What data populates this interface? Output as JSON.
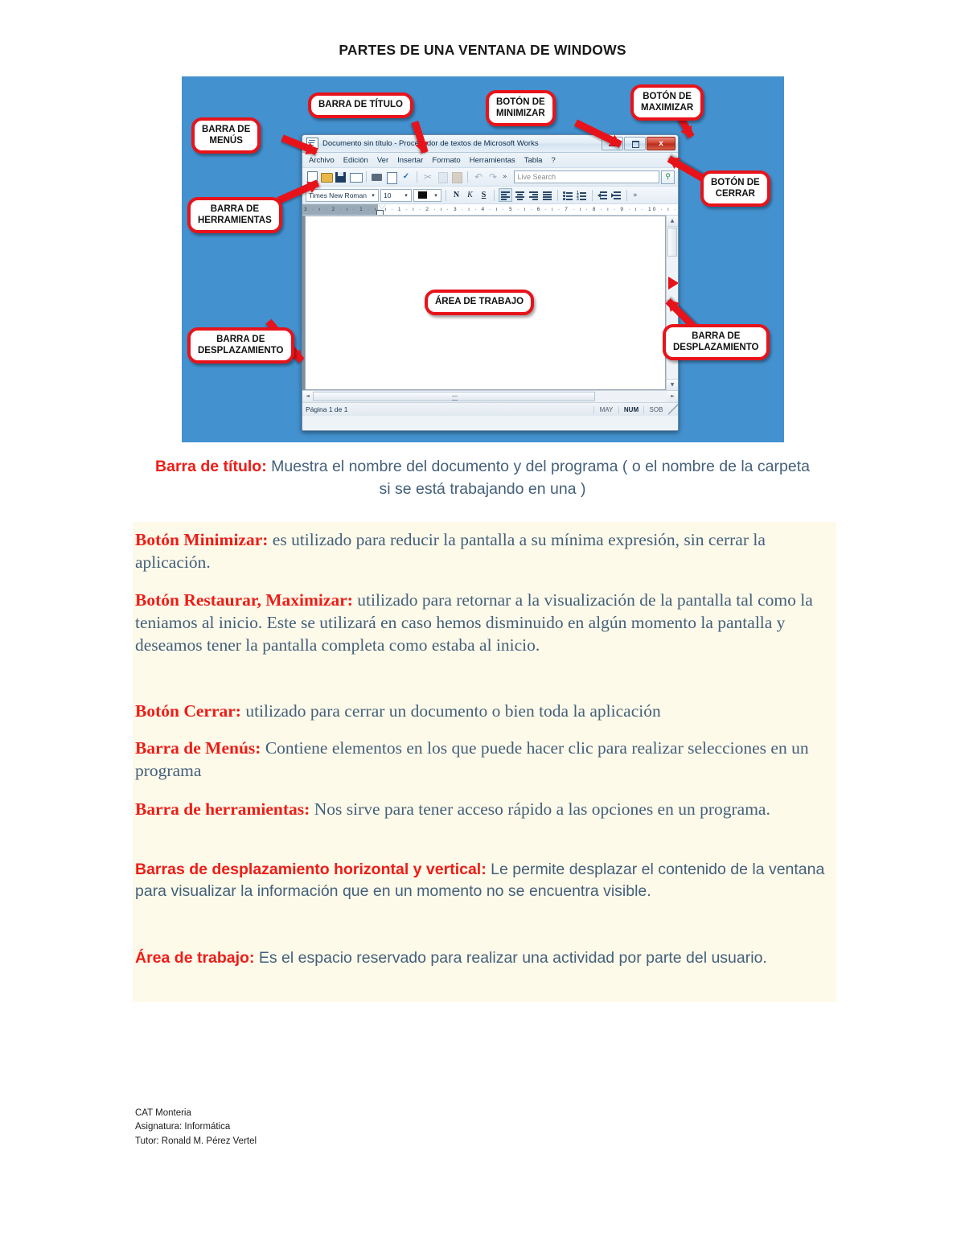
{
  "document": {
    "title": "PARTES DE UNA VENTANA DE WINDOWS"
  },
  "figure": {
    "background_color": "#4391cf",
    "callouts": [
      {
        "id": "barra-de-titulo",
        "line1": "BARRA DE TÍTULO",
        "line2": ""
      },
      {
        "id": "barra-de-menus",
        "line1": "BARRA DE",
        "line2": "MENÚS"
      },
      {
        "id": "barra-de-herramientas",
        "line1": "BARRA DE",
        "line2": "HERRAMIENTAS"
      },
      {
        "id": "boton-de-minimizar",
        "line1": "BOTÓN DE",
        "line2": "MINIMIZAR"
      },
      {
        "id": "boton-de-maximizar",
        "line1": "BOTÓN DE",
        "line2": "MAXIMIZAR"
      },
      {
        "id": "boton-de-cerrar",
        "line1": "BOTÓN DE",
        "line2": "CERRAR"
      },
      {
        "id": "area-de-trabajo",
        "line1": "ÁREA DE TRABAJO",
        "line2": ""
      },
      {
        "id": "barra-desplazamiento-h",
        "line1": "BARRA DE",
        "line2": "DESPLAZAMIENTO"
      },
      {
        "id": "barra-desplazamiento-v",
        "line1": "BARRA DE",
        "line2": "DESPLAZAMIENTO"
      }
    ],
    "window": {
      "title": "Documento sin título - Procesador de textos de Microsoft Works",
      "window_buttons": {
        "minimize": "minimize-icon",
        "maximize": "maximize-icon",
        "close": "x"
      },
      "menu_items": [
        "Archivo",
        "Edición",
        "Ver",
        "Insertar",
        "Formato",
        "Herramientas",
        "Tabla",
        "?"
      ],
      "toolbar_icons": [
        "new-document-icon",
        "open-folder-icon",
        "save-icon",
        "mail-icon",
        "print-icon",
        "print-preview-icon",
        "spellcheck-icon",
        "cut-icon",
        "copy-icon",
        "paste-icon",
        "undo-icon",
        "redo-icon"
      ],
      "toolbar_overflow": "»",
      "search": {
        "placeholder": "Live Search",
        "button_icon": "search-icon"
      },
      "format_bar": {
        "font_name": "Times New Roman",
        "font_size": "10",
        "font_color_swatch": "#0d0d0d",
        "bold_label": "N",
        "italic_label": "K",
        "underline_label": "S",
        "align_icons": [
          "align-left-icon",
          "align-center-icon",
          "align-right-icon",
          "align-justify-icon"
        ],
        "list_icons": [
          "bullet-list-icon",
          "numbered-list-icon"
        ],
        "indent_icons": [
          "decrease-indent-icon",
          "increase-indent-icon"
        ],
        "overflow": "»"
      },
      "ruler": {
        "left_margin_ticks": "3 · ı · 2 · ı · 1 · ı ·",
        "ticks": "· ı · 1 · ı · 2 · ı · 3 · ı · 4 · ı · 5 · ı · 6 · ı · 7 · ı · 8 · ı · 9 · ı · 10 · ı · 11 · ı"
      },
      "scrollbars": {
        "up_arrow": "▲",
        "down_arrow": "▼",
        "left_arrow": "◄",
        "right_arrow": "►"
      },
      "status_bar": {
        "page_info": "Página 1 de 1",
        "indicators": [
          {
            "label": "MAY",
            "active": false
          },
          {
            "label": "NUM",
            "active": true
          },
          {
            "label": "SOB",
            "active": false
          }
        ]
      }
    }
  },
  "content": {
    "lead": {
      "label": "Barra de título:",
      "text": " Muestra el nombre del documento y del programa ( o el nombre de la carpeta si se está trabajando en una )"
    },
    "paragraphs": [
      {
        "id": "boton-minimizar",
        "label": "Botón Minimizar:",
        "text": " es utilizado para reducir la pantalla a su mínima expresión, sin cerrar la aplicación.",
        "style": "serif"
      },
      {
        "id": "boton-restaurar-maximizar",
        "label": "Botón Restaurar, Maximizar:",
        "text": " utilizado para retornar a la visualización de la pantalla tal como la teniamos al inicio. Este se utilizará en caso hemos disminuido en algún momento la pantalla y deseamos tener la pantalla completa como estaba al inicio.",
        "style": "serif"
      },
      {
        "id": "boton-cerrar",
        "label": "Botón Cerrar:",
        "text": " utilizado para cerrar un documento o bien toda la aplicación",
        "style": "serif"
      },
      {
        "id": "barra-de-menus",
        "label": "Barra de Menús:",
        "text": " Contiene elementos en los que puede hacer clic  para realizar selecciones en un programa",
        "style": "serif"
      },
      {
        "id": "barra-de-herramientas",
        "label": "Barra de herramientas:",
        "text": " Nos sirve para tener acceso rápido a  las opciones en un programa.",
        "style": "serif"
      },
      {
        "id": "barras-de-desplazamiento",
        "label": "Barras de desplazamiento horizontal y vertical:",
        "text": " Le permite desplazar el contenido de la ventana para visualizar la información que en un momento no se encuentra visible.",
        "style": "sans"
      },
      {
        "id": "area-de-trabajo",
        "label": "Área de trabajo:",
        "text": " Es el espacio reservado para realizar una actividad por parte del usuario.",
        "style": "sans"
      }
    ]
  },
  "footer": {
    "line1": "CAT Monteria",
    "line2": "Asignatura: Informática",
    "line3": "Tutor: Ronald M. Pérez Vertel"
  },
  "colors": {
    "label_red": "#ee1c16",
    "body_blue_gray": "#44607a",
    "callout_red": "#e8131a",
    "figure_blue": "#4391cf",
    "cream": "#fdfaea"
  }
}
